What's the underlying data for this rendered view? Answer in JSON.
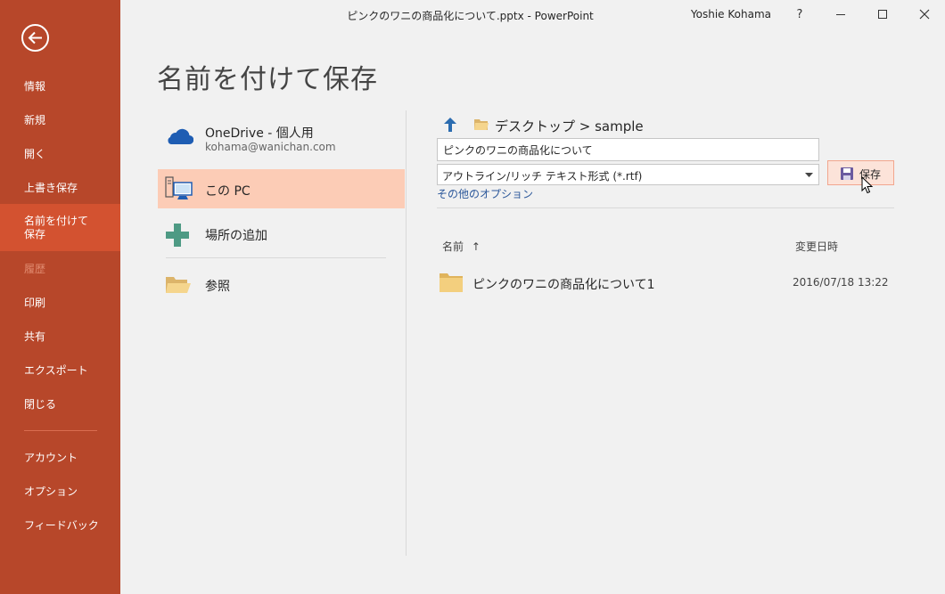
{
  "window": {
    "title": "ピンクのワニの商品化について.pptx - PowerPoint",
    "user": "Yoshie Kohama",
    "help": "?",
    "minimize": "—",
    "maximize": "☐",
    "close": "✕"
  },
  "rail": {
    "items": [
      {
        "label": "情報"
      },
      {
        "label": "新規"
      },
      {
        "label": "開く"
      },
      {
        "label": "上書き保存"
      },
      {
        "label": "名前を付けて\n保存"
      },
      {
        "label": "履歴"
      },
      {
        "label": "印刷"
      },
      {
        "label": "共有"
      },
      {
        "label": "エクスポート"
      },
      {
        "label": "閉じる"
      },
      {
        "label": "アカウント"
      },
      {
        "label": "オプション"
      },
      {
        "label": "フィードバック"
      }
    ],
    "selected_index": 4,
    "disabled_index": 5,
    "colors": {
      "rail": "#b7472a",
      "selected": "#d35230",
      "disabled_text": "#e08a6f"
    }
  },
  "page_title": "名前を付けて保存",
  "places": {
    "onedrive": {
      "label": "OneDrive - 個人用",
      "sub": "kohama@wanichan.com",
      "icon": "onedrive-cloud-icon"
    },
    "this_pc": {
      "label": "この PC",
      "icon": "computer-icon",
      "selected": true
    },
    "add_place": {
      "label": "場所の追加",
      "icon": "plus-icon"
    },
    "browse": {
      "label": "参照",
      "icon": "open-folder-icon"
    },
    "selected_color": "#fcccb6"
  },
  "save_pane": {
    "path": "デスクトップ > sample",
    "filename": "ピンクのワニの商品化について",
    "filetype": "アウトライン/リッチ テキスト形式 (*.rtf)",
    "save_label": "保存",
    "more_options": "その他のオプション",
    "columns": {
      "name": "名前",
      "sort_indicator": "↑",
      "modified": "変更日時"
    },
    "files": [
      {
        "name": "ピンクのワニの商品化について1",
        "modified": "2016/07/18 13:22",
        "icon": "folder-icon"
      }
    ]
  }
}
